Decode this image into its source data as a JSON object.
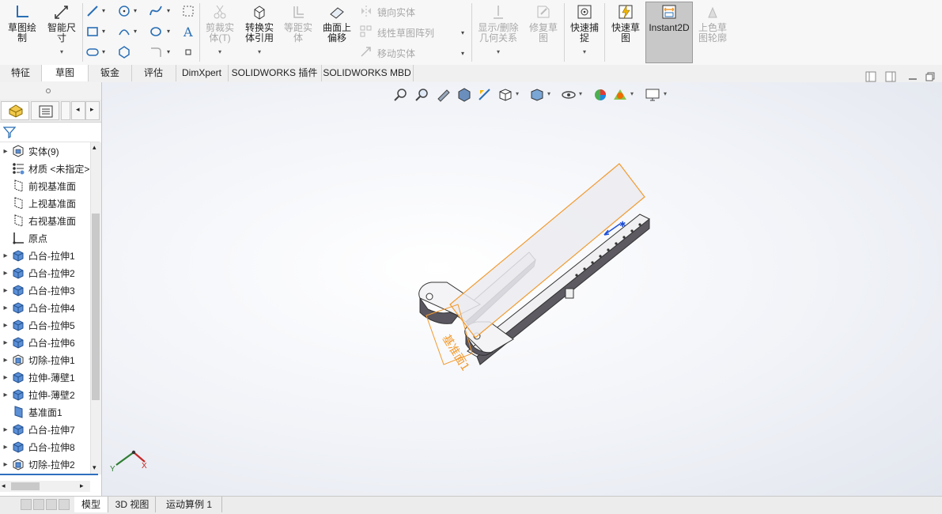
{
  "ribbon": {
    "sketch_btn": "草图绘\n制",
    "smart_dim_btn": "智能尺\n寸",
    "trim_btn": "剪裁实\n体(T)",
    "convert_btn": "转换实\n体引用",
    "offset_btn": "等距实\n体",
    "offset_surface_btn": "曲面上\n偏移",
    "mirror_btn": "镜向实体",
    "linear_pattern_btn": "线性草图阵列",
    "move_btn": "移动实体",
    "relations_btn": "显示/删除\n几何关系",
    "repair_btn": "修复草\n图",
    "quick_snap_btn": "快速捕\n捉",
    "rapid_sketch_btn": "快速草\n图",
    "instant2d_btn": "Instant2D",
    "shade_btn": "上色草\n图轮廓"
  },
  "tabs": [
    "特征",
    "草图",
    "钣金",
    "评估",
    "DimXpert",
    "SOLIDWORKS 插件",
    "SOLIDWORKS MBD"
  ],
  "tree": [
    {
      "label": "实体(9)",
      "icon": "solid-bodies-icon",
      "arrow": true
    },
    {
      "label": "材质 <未指定>",
      "icon": "material-icon",
      "arrow": false
    },
    {
      "label": "前视基准面",
      "icon": "plane-icon",
      "arrow": false
    },
    {
      "label": "上视基准面",
      "icon": "plane-icon",
      "arrow": false
    },
    {
      "label": "右视基准面",
      "icon": "plane-icon",
      "arrow": false
    },
    {
      "label": "原点",
      "icon": "origin-icon",
      "arrow": false
    },
    {
      "label": "凸台-拉伸1",
      "icon": "extrude-icon",
      "arrow": true
    },
    {
      "label": "凸台-拉伸2",
      "icon": "extrude-icon",
      "arrow": true
    },
    {
      "label": "凸台-拉伸3",
      "icon": "extrude-icon",
      "arrow": true
    },
    {
      "label": "凸台-拉伸4",
      "icon": "extrude-icon",
      "arrow": true
    },
    {
      "label": "凸台-拉伸5",
      "icon": "extrude-icon",
      "arrow": true
    },
    {
      "label": "凸台-拉伸6",
      "icon": "extrude-icon",
      "arrow": true
    },
    {
      "label": "切除-拉伸1",
      "icon": "cut-icon",
      "arrow": true
    },
    {
      "label": "拉伸-薄壁1",
      "icon": "extrude-icon",
      "arrow": true
    },
    {
      "label": "拉伸-薄壁2",
      "icon": "extrude-icon",
      "arrow": true
    },
    {
      "label": "基准面1",
      "icon": "plane-blue-icon",
      "arrow": false
    },
    {
      "label": "凸台-拉伸7",
      "icon": "extrude-icon",
      "arrow": true
    },
    {
      "label": "凸台-拉伸8",
      "icon": "extrude-icon",
      "arrow": true
    },
    {
      "label": "切除-拉伸2",
      "icon": "cut-icon",
      "arrow": true
    }
  ],
  "plane_label": "基准面1",
  "triad": {
    "x": "X",
    "y": "Y"
  },
  "bottom_tabs": [
    "模型",
    "3D 视图",
    "运动算例 1"
  ],
  "colors": {
    "accent_orange": "#f29a2e",
    "selection_blue": "#2f6fbf"
  }
}
